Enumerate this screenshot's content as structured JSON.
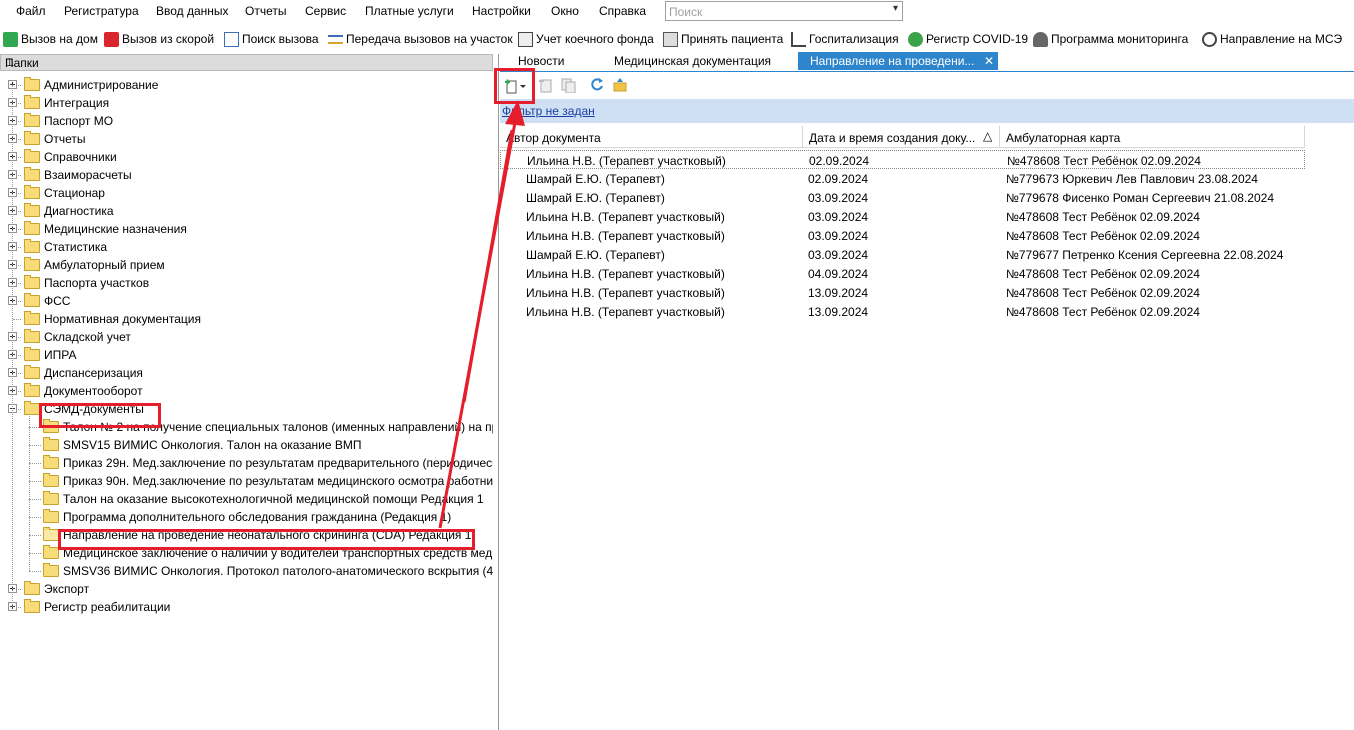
{
  "menu": [
    "Файл",
    "Регистратура",
    "Ввод данных",
    "Отчеты",
    "Сервис",
    "Платные услуги",
    "Настройки",
    "Окно",
    "Справка"
  ],
  "search": {
    "placeholder": "Поиск"
  },
  "toolbar": [
    {
      "label": "Вызов на дом",
      "icon": "green-check-icon"
    },
    {
      "label": "Вызов из скорой",
      "icon": "ambulance-icon"
    },
    {
      "label": "Поиск вызова",
      "icon": "search-doc-icon"
    },
    {
      "label": "Передача вызовов на участок",
      "icon": "transfer-icon"
    },
    {
      "label": "Учет коечного фонда",
      "icon": "bed-icon"
    },
    {
      "label": "Принять пациента",
      "icon": "printer-icon"
    },
    {
      "label": "Госпитализация",
      "icon": "hospital-bed-icon"
    },
    {
      "label": "Регистр COVID-19",
      "icon": "virus-icon"
    },
    {
      "label": "Программа мониторинга",
      "icon": "people-icon"
    },
    {
      "label": "Направление на МСЭ",
      "icon": "msa-icon"
    }
  ],
  "left_panel": {
    "title": "Папки",
    "tree": [
      {
        "label": "Администрирование",
        "level": 0,
        "expander": "plus"
      },
      {
        "label": "Интеграция",
        "level": 0,
        "expander": "plus"
      },
      {
        "label": "Паспорт МО",
        "level": 0,
        "expander": "plus"
      },
      {
        "label": "Отчеты",
        "level": 0,
        "expander": "plus"
      },
      {
        "label": "Справочники",
        "level": 0,
        "expander": "plus"
      },
      {
        "label": "Взаиморасчеты",
        "level": 0,
        "expander": "plus"
      },
      {
        "label": "Стационар",
        "level": 0,
        "expander": "plus"
      },
      {
        "label": "Диагностика",
        "level": 0,
        "expander": "plus"
      },
      {
        "label": "Медицинские назначения",
        "level": 0,
        "expander": "plus"
      },
      {
        "label": "Статистика",
        "level": 0,
        "expander": "plus"
      },
      {
        "label": "Амбулаторный прием",
        "level": 0,
        "expander": "plus"
      },
      {
        "label": "Паспорта участков",
        "level": 0,
        "expander": "plus"
      },
      {
        "label": "ФСС",
        "level": 0,
        "expander": "plus"
      },
      {
        "label": "Нормативная документация",
        "level": 0,
        "expander": "none"
      },
      {
        "label": "Складской учет",
        "level": 0,
        "expander": "plus"
      },
      {
        "label": "ИПРА",
        "level": 0,
        "expander": "plus"
      },
      {
        "label": "Диспансеризация",
        "level": 0,
        "expander": "plus"
      },
      {
        "label": "Документооборот",
        "level": 0,
        "expander": "plus"
      },
      {
        "label": "СЭМД-документы",
        "level": 0,
        "expander": "minus",
        "highlight": true
      },
      {
        "label": "Талон № 2 на получение специальных талонов (именных направлений) на пр",
        "level": 1
      },
      {
        "label": "SMSV15 ВИМИС Онкология. Талон на оказание ВМП",
        "level": 1
      },
      {
        "label": "Приказ 29н. Мед.заключение по результатам предварительного (периодическ",
        "level": 1
      },
      {
        "label": "Приказ 90н. Мед.заключение по результатам медицинского осмотра работни",
        "level": 1
      },
      {
        "label": "Талон на оказание высокотехнологичной медицинской помощи Редакция 1",
        "level": 1
      },
      {
        "label": "Программа дополнительного обследования гражданина (Редакция 1)",
        "level": 1
      },
      {
        "label": "Направление на проведение неонатального скрининга (CDA) Редакция 1",
        "level": 1,
        "highlight": true,
        "open": true
      },
      {
        "label": "Медицинское заключение о наличии у водителей транспортных средств мед",
        "level": 1
      },
      {
        "label": "SMSV36 ВИМИС Онкология. Протокол патолого-анатомического вскрытия (4",
        "level": 1
      },
      {
        "label": "Экспорт",
        "level": 0,
        "expander": "plus"
      },
      {
        "label": "Регистр реабилитации",
        "level": 0,
        "expander": "plus"
      }
    ]
  },
  "tabs": [
    {
      "label": "Новости",
      "active": false
    },
    {
      "label": "Медицинская документация",
      "active": false
    },
    {
      "label": "Направление на проведени...",
      "active": true
    }
  ],
  "tab_close": "✕",
  "filter_link": "Фильтр не задан",
  "grid": {
    "columns": [
      "Автор документа",
      "Дата и время создания доку...",
      "Амбулаторная карта"
    ],
    "sort_indicator": "△",
    "rows": [
      [
        "Ильина Н.В. (Терапевт участковый)",
        "02.09.2024",
        "№478608 Тест Ребёнок  02.09.2024"
      ],
      [
        "Шамрай Е.Ю. (Терапевт)",
        "02.09.2024",
        "№779673 Юркевич Лев Павлович 23.08.2024"
      ],
      [
        "Шамрай Е.Ю. (Терапевт)",
        "03.09.2024",
        "№779678 Фисенко Роман Сергеевич 21.08.2024"
      ],
      [
        "Ильина Н.В. (Терапевт участковый)",
        "03.09.2024",
        "№478608 Тест Ребёнок  02.09.2024"
      ],
      [
        "Ильина Н.В. (Терапевт участковый)",
        "03.09.2024",
        "№478608 Тест Ребёнок  02.09.2024"
      ],
      [
        "Шамрай Е.Ю. (Терапевт)",
        "03.09.2024",
        "№779677 Петренко Ксения Сергеевна 22.08.2024"
      ],
      [
        "Ильина Н.В. (Терапевт участковый)",
        "04.09.2024",
        "№478608 Тест Ребёнок  02.09.2024"
      ],
      [
        "Ильина Н.В. (Терапевт участковый)",
        "13.09.2024",
        "№478608 Тест Ребёнок  02.09.2024"
      ],
      [
        "Ильина Н.В. (Терапевт участковый)",
        "13.09.2024",
        "№478608 Тест Ребёнок  02.09.2024"
      ]
    ]
  },
  "colors": {
    "accent": "#2e85cc",
    "annotation": "#e41e2b",
    "filter_bg": "#cfe0f5"
  }
}
